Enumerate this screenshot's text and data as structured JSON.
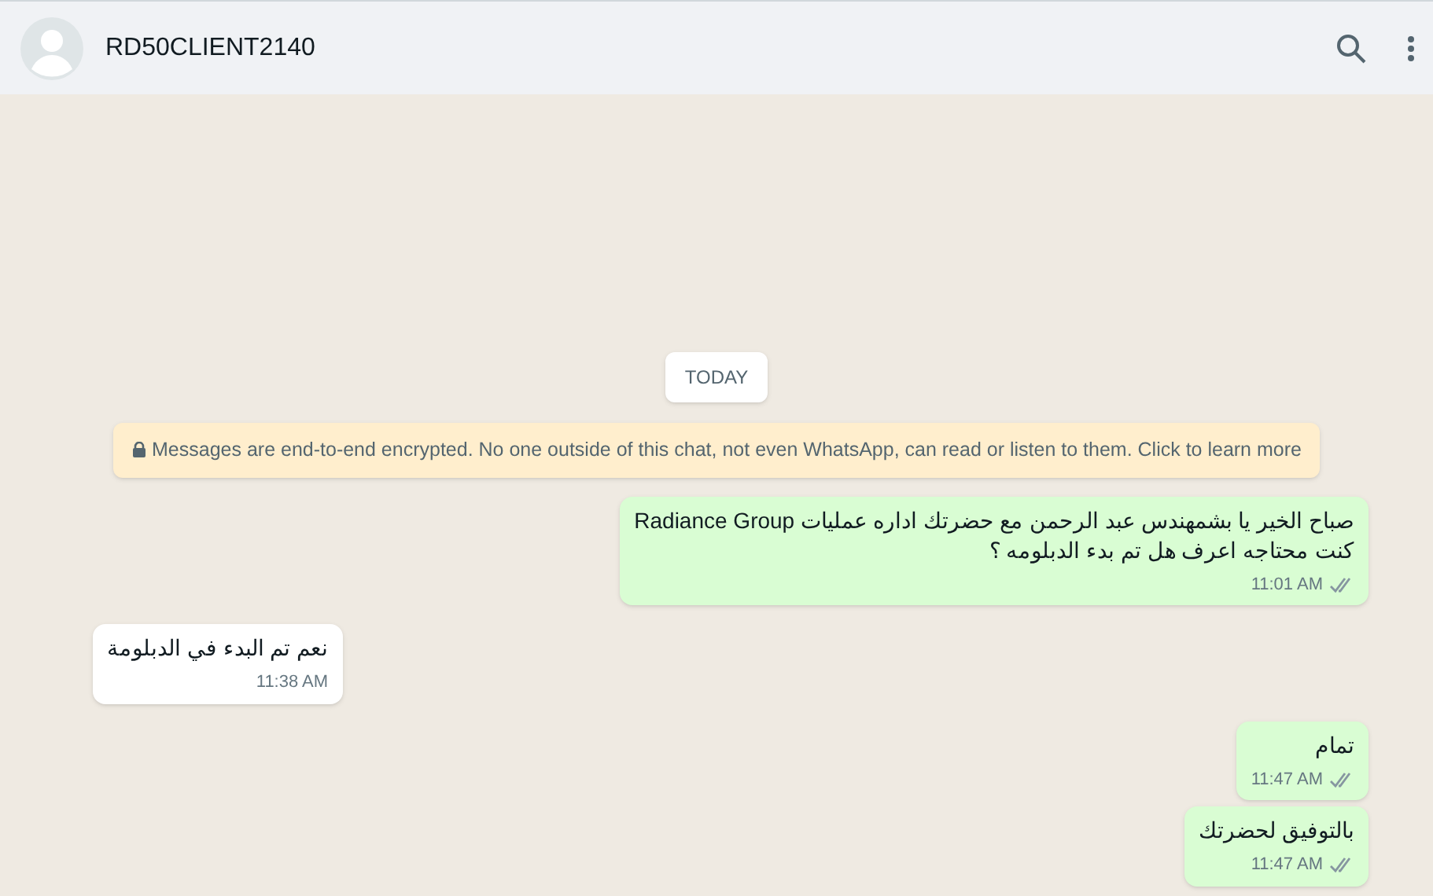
{
  "header": {
    "contact_name": "RD50CLIENT2140"
  },
  "date_divider": "TODAY",
  "encryption_notice": "Messages are end-to-end encrypted. No one outside of this chat, not even WhatsApp, can read or listen to them. Click to learn more",
  "messages": [
    {
      "kind": "outgoing",
      "lines": [
        "صباح الخير يا بشمهندس عبد الرحمن مع حضرتك اداره عمليات Radiance Group",
        "كنت محتاجه اعرف هل تم بدء الدبلومه ؟"
      ],
      "time": "11:01 AM",
      "delivered": true
    },
    {
      "kind": "incoming",
      "lines": [
        "نعم تم البدء في الدبلومة"
      ],
      "time": "11:38 AM"
    },
    {
      "kind": "outgoing",
      "lines": [
        "تمام"
      ],
      "time": "11:47 AM",
      "delivered": true
    },
    {
      "kind": "outgoing",
      "lines": [
        "بالتوفيق لحضرتك"
      ],
      "time": "11:47 AM",
      "delivered": true
    }
  ]
}
